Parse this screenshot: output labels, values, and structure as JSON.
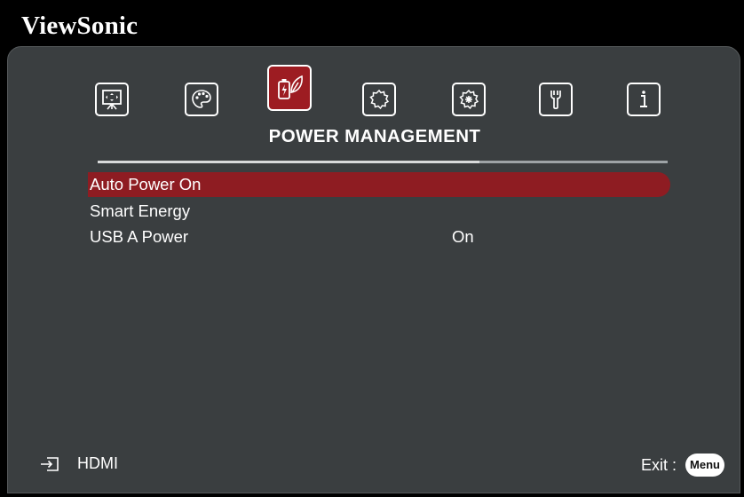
{
  "brand": "ViewSonic",
  "tabs": [
    {
      "icon": "display-icon",
      "active": false
    },
    {
      "icon": "color-palette-icon",
      "active": false
    },
    {
      "icon": "power-management-icon",
      "active": true
    },
    {
      "icon": "basic-settings-icon",
      "active": false
    },
    {
      "icon": "advanced-settings-icon",
      "active": false
    },
    {
      "icon": "tool-icon",
      "active": false
    },
    {
      "icon": "information-icon",
      "active": false
    }
  ],
  "section_title": "POWER MANAGEMENT",
  "menu": [
    {
      "label": "Auto Power On",
      "value": "",
      "selected": true
    },
    {
      "label": "Smart Energy",
      "value": "",
      "selected": false
    },
    {
      "label": "USB A Power",
      "value": "On",
      "selected": false
    }
  ],
  "footer": {
    "source_label": "HDMI",
    "exit_label": "Exit :",
    "menu_key": "Menu"
  },
  "colors": {
    "accent": "#9d1c22",
    "panel": "#3a3e40",
    "background": "#000000"
  }
}
